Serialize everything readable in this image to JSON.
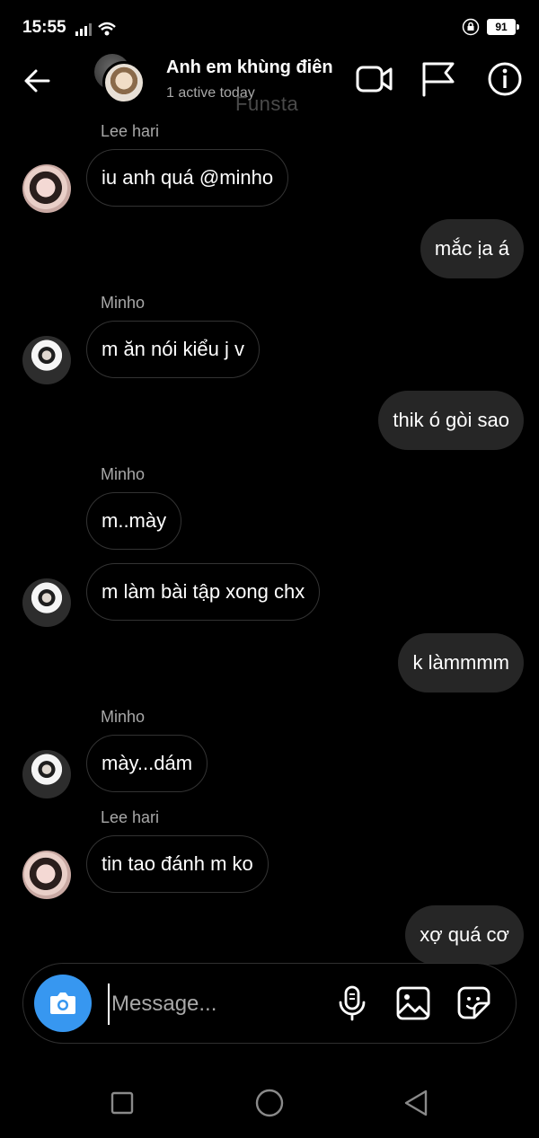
{
  "status_bar": {
    "time": "15:55",
    "battery": "91"
  },
  "header": {
    "title": "Anh em khùng điên",
    "subtitle": "1 active today",
    "watermark": "Funsta"
  },
  "messages": [
    {
      "sender": "Lee hari",
      "text": "iu anh quá @minho",
      "direction": "in",
      "avatar": "lee-hari-avatar"
    },
    {
      "text": "mắc ịa á",
      "direction": "out"
    },
    {
      "sender": "Minho",
      "text": "m ăn nói kiểu j v",
      "direction": "in",
      "avatar": "minho-avatar"
    },
    {
      "text": "thik ó gòi sao",
      "direction": "out"
    },
    {
      "sender": "Minho",
      "text": "m..mày",
      "direction": "in"
    },
    {
      "text": "m làm bài tập xong chx",
      "direction": "in",
      "avatar": "minho-avatar"
    },
    {
      "text": "k làmmmm",
      "direction": "out"
    },
    {
      "sender": "Minho",
      "text": "mày...dám",
      "direction": "in",
      "avatar": "minho-avatar"
    },
    {
      "sender": "Lee hari",
      "text": "tin tao đánh m ko",
      "direction": "in",
      "avatar": "lee-hari-avatar"
    },
    {
      "text": "xợ quá cơ",
      "direction": "out"
    }
  ],
  "composer": {
    "placeholder": "Message..."
  },
  "icons": {
    "back": "back-arrow-icon",
    "video": "video-call-icon",
    "flag": "flag-icon",
    "info": "info-icon",
    "camera": "camera-icon",
    "mic": "microphone-icon",
    "gallery": "gallery-icon",
    "sticker": "sticker-icon"
  },
  "colors": {
    "background": "#000000",
    "accent": "#3797f0",
    "outgoing_bubble": "#262626",
    "muted_text": "#a8a8a8"
  }
}
